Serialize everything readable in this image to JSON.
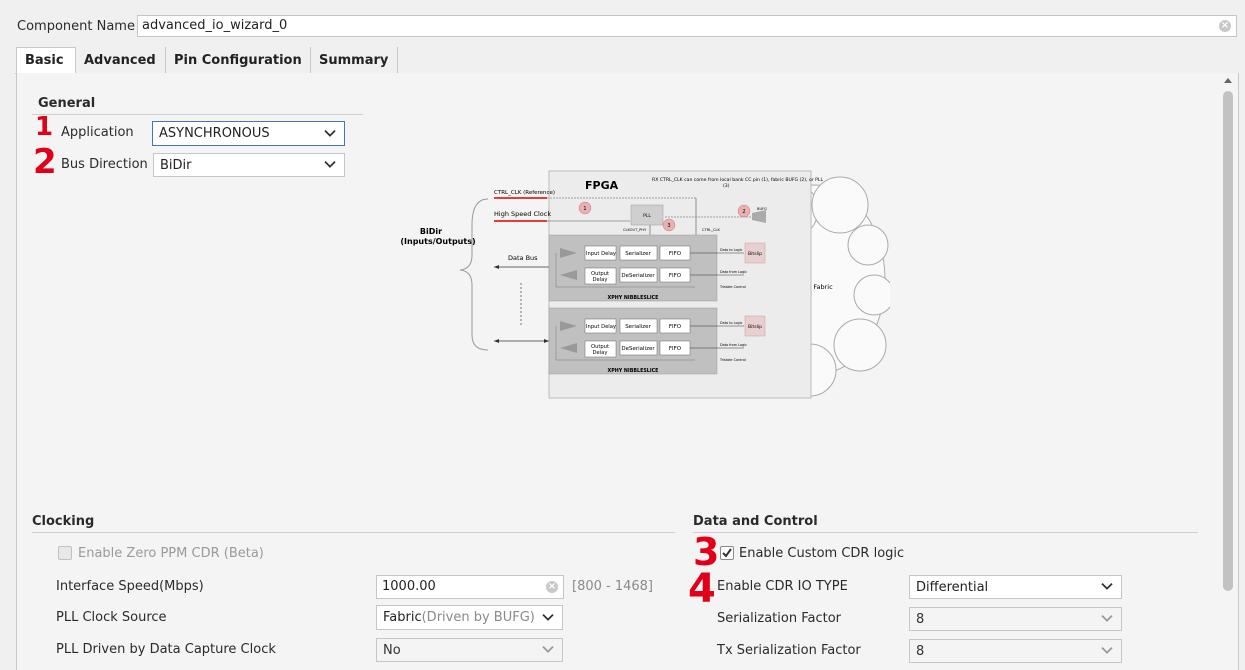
{
  "header": {
    "component_label": "Component Name",
    "component_value": "advanced_io_wizard_0"
  },
  "tabs": [
    {
      "label": "Basic",
      "active": true
    },
    {
      "label": "Advanced",
      "active": false
    },
    {
      "label": "Pin Configuration",
      "active": false
    },
    {
      "label": "Summary",
      "active": false
    }
  ],
  "general": {
    "title": "General",
    "application_label": "Application",
    "application_value": "ASYNCHRONOUS",
    "bus_direction_label": "Bus Direction",
    "bus_direction_value": "BiDir"
  },
  "annotations": [
    "1",
    "2",
    "3",
    "4"
  ],
  "diagram": {
    "bidir_label_line1": "BiDir",
    "bidir_label_line2": "(Inputs/Outputs)",
    "fpga": "FPGA",
    "rx_note_line1": "RX CTRL_CLK  can come from local bank CC pin (1), fabric BUFG (2), or PLL",
    "rx_note_line2": "(3)",
    "ctrl_clk_ref": "CTRL_CLK (Reference)",
    "high_speed_clock": "High Speed Clock",
    "pll": "PLL",
    "clkout_phy": "CLKOUT_PHY",
    "ctrl_clk": "CTRL_CLK",
    "bufg": "BUFG",
    "data_bus": "Data Bus",
    "input_delay": "Input Delay",
    "serializer": "Serializer",
    "fifo": "FIFO",
    "output_delay_1": "Output",
    "output_delay_2": "Delay",
    "deserializer": "DeSerializer",
    "xphy": "XPHY NIBBLESLICE",
    "bitslip": "Bitslip",
    "data_to_logic": "Data to Logic",
    "data_from_logic": "Data from Logic",
    "tristate_control": "Tristate Control",
    "fabric": "Fabric",
    "marker1": "1",
    "marker2": "2",
    "marker3": "3"
  },
  "clocking": {
    "title": "Clocking",
    "zero_ppm_label": "Enable Zero PPM CDR (Beta)",
    "zero_ppm_checked": false,
    "interface_speed_label": "Interface Speed(Mbps)",
    "interface_speed_value": "1000.00",
    "interface_speed_range": "[800 - 1468]",
    "pll_source_label": "PLL Clock Source",
    "pll_source_value": "Fabric",
    "pll_source_hint": "(Driven by BUFG)",
    "pll_driven_label": "PLL Driven by Data Capture Clock",
    "pll_driven_value": "No"
  },
  "data_control": {
    "title": "Data and Control",
    "custom_cdr_label": "Enable Custom CDR logic",
    "custom_cdr_checked": true,
    "cdr_io_type_label": "Enable CDR IO TYPE",
    "cdr_io_type_value": "Differential",
    "serialization_label": "Serialization Factor",
    "serialization_value": "8",
    "tx_serialization_label": "Tx Serialization Factor",
    "tx_serialization_value": "8"
  }
}
